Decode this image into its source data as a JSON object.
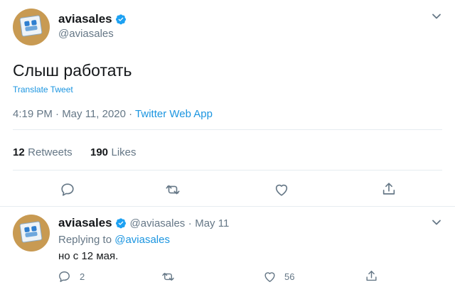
{
  "tweet": {
    "name": "aviasales",
    "handle": "@aviasales",
    "text": "Слыш работать",
    "translate_label": "Translate Tweet",
    "timestamp": "4:19 PM · May 11, 2020 · ",
    "source": "Twitter Web App",
    "retweets_count": "12",
    "retweets_label": "Retweets",
    "likes_count": "190",
    "likes_label": "Likes"
  },
  "reply": {
    "name": "aviasales",
    "handle": "@aviasales",
    "dot": "·",
    "date": "May 11",
    "replying_prefix": "Replying to ",
    "replying_handle": "@aviasales",
    "text": "но с 12 мая.",
    "reply_count": "2",
    "like_count": "56"
  },
  "icons": {
    "verified": "verified-badge-icon",
    "more": "chevron-down-icon",
    "reply": "reply-icon",
    "retweet": "retweet-icon",
    "like": "heart-icon",
    "share": "share-icon"
  },
  "colors": {
    "accent": "#1b95e0",
    "text": "#14171a",
    "muted": "#657786",
    "divider": "#e6ecf0"
  }
}
